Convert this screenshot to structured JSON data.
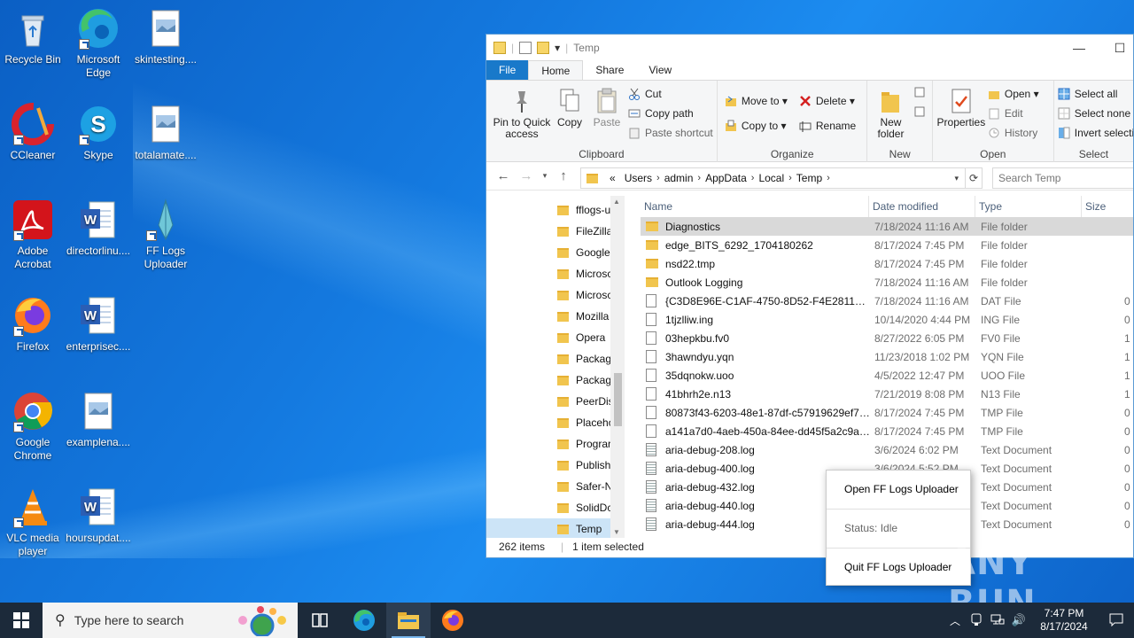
{
  "desktop": {
    "icons": [
      {
        "label": "Recycle Bin",
        "icon": "recycle-bin-icon"
      },
      {
        "label": "Microsoft Edge",
        "icon": "edge-icon"
      },
      {
        "label": "skintesting....",
        "icon": "image-file-icon"
      },
      {
        "label": "CCleaner",
        "icon": "ccleaner-icon"
      },
      {
        "label": "Skype",
        "icon": "skype-icon"
      },
      {
        "label": "totalamate....",
        "icon": "image-file-icon"
      },
      {
        "label": "Adobe Acrobat",
        "icon": "acrobat-icon"
      },
      {
        "label": "directorlinu....",
        "icon": "word-doc-icon"
      },
      {
        "label": "FF Logs Uploader",
        "icon": "ff-logs-icon"
      },
      {
        "label": "Firefox",
        "icon": "firefox-icon"
      },
      {
        "label": "enterprisec....",
        "icon": "word-doc-icon"
      },
      {
        "label": "Google Chrome",
        "icon": "chrome-icon"
      },
      {
        "label": "examplena....",
        "icon": "image-file-icon"
      },
      {
        "label": "VLC media player",
        "icon": "vlc-icon"
      },
      {
        "label": "hoursupdat....",
        "icon": "word-doc-icon"
      }
    ]
  },
  "explorer": {
    "title": "Temp",
    "menu_tabs": {
      "file": "File",
      "home": "Home",
      "share": "Share",
      "view": "View"
    },
    "ribbon": {
      "pin": "Pin to Quick access",
      "copy": "Copy",
      "paste": "Paste",
      "cut": "Cut",
      "copy_path": "Copy path",
      "paste_shortcut": "Paste shortcut",
      "clipboard": "Clipboard",
      "move_to": "Move to",
      "copy_to": "Copy to",
      "delete": "Delete",
      "rename": "Rename",
      "organize": "Organize",
      "new_folder": "New folder",
      "new": "New",
      "properties": "Properties",
      "open_btn": "Open",
      "edit": "Edit",
      "history": "History",
      "open": "Open",
      "select_all": "Select all",
      "select_none": "Select none",
      "invert_selection": "Invert selection",
      "select": "Select"
    },
    "address": {
      "prefix": "«",
      "crumbs": [
        "Users",
        "admin",
        "AppData",
        "Local",
        "Temp"
      ],
      "search_placeholder": "Search Temp"
    },
    "nav_items": [
      "fflogs-u",
      "FileZilla",
      "Google",
      "Microsc",
      "Microsc",
      "Mozilla",
      "Opera",
      "Packag",
      "Packag",
      "PeerDis",
      "Placeho",
      "Prograr",
      "Publish",
      "Safer-N",
      "SolidDc",
      "Temp"
    ],
    "columns": {
      "name": "Name",
      "date": "Date modified",
      "type": "Type",
      "size": "Size"
    },
    "files": [
      {
        "name": "Diagnostics",
        "date": "7/18/2024 11:16 AM",
        "type": "File folder",
        "size": "",
        "kind": "folder"
      },
      {
        "name": "edge_BITS_6292_1704180262",
        "date": "8/17/2024 7:45 PM",
        "type": "File folder",
        "size": "",
        "kind": "folder"
      },
      {
        "name": "nsd22.tmp",
        "date": "8/17/2024 7:45 PM",
        "type": "File folder",
        "size": "",
        "kind": "folder"
      },
      {
        "name": "Outlook Logging",
        "date": "7/18/2024 11:16 AM",
        "type": "File folder",
        "size": "",
        "kind": "folder"
      },
      {
        "name": "{C3D8E96E-C1AF-4750-8D52-F4E28119C1...",
        "date": "7/18/2024 11:16 AM",
        "type": "DAT File",
        "size": "0",
        "kind": "file"
      },
      {
        "name": "1tjzlliw.ing",
        "date": "10/14/2020 4:44 PM",
        "type": "ING File",
        "size": "0",
        "kind": "file"
      },
      {
        "name": "03hepkbu.fv0",
        "date": "8/27/2022 6:05 PM",
        "type": "FV0 File",
        "size": "1",
        "kind": "file"
      },
      {
        "name": "3hawndyu.yqn",
        "date": "11/23/2018 1:02 PM",
        "type": "YQN File",
        "size": "1",
        "kind": "file"
      },
      {
        "name": "35dqnokw.uoo",
        "date": "4/5/2022 12:47 PM",
        "type": "UOO File",
        "size": "1",
        "kind": "file"
      },
      {
        "name": "41bhrh2e.n13",
        "date": "7/21/2019 8:08 PM",
        "type": "N13 File",
        "size": "1",
        "kind": "file"
      },
      {
        "name": "80873f43-6203-48e1-87df-c57919629ef7.t...",
        "date": "8/17/2024 7:45 PM",
        "type": "TMP File",
        "size": "0",
        "kind": "file"
      },
      {
        "name": "a141a7d0-4aeb-450a-84ee-dd45f5a2c9af....",
        "date": "8/17/2024 7:45 PM",
        "type": "TMP File",
        "size": "0",
        "kind": "file"
      },
      {
        "name": "aria-debug-208.log",
        "date": "3/6/2024 6:02 PM",
        "type": "Text Document",
        "size": "0",
        "kind": "txt"
      },
      {
        "name": "aria-debug-400.log",
        "date": "3/6/2024 5:52 PM",
        "type": "Text Document",
        "size": "0",
        "kind": "txt"
      },
      {
        "name": "aria-debug-432.log",
        "date": "",
        "type": "Text Document",
        "size": "0",
        "kind": "txt"
      },
      {
        "name": "aria-debug-440.log",
        "date": "",
        "type": "Text Document",
        "size": "0",
        "kind": "txt"
      },
      {
        "name": "aria-debug-444.log",
        "date": "",
        "type": "Text Document",
        "size": "0",
        "kind": "txt"
      }
    ],
    "status": {
      "count": "262 items",
      "selected": "1 item selected"
    }
  },
  "context_menu": {
    "open": "Open FF Logs Uploader",
    "status": "Status: Idle",
    "quit": "Quit FF Logs Uploader"
  },
  "watermark": "ANY RUN",
  "taskbar": {
    "search_placeholder": "Type here to search",
    "time": "7:47 PM",
    "date": "8/17/2024"
  },
  "colors": {
    "accent": "#1979ca",
    "selection": "#cce4f7",
    "taskbar": "#1c2a3a"
  }
}
